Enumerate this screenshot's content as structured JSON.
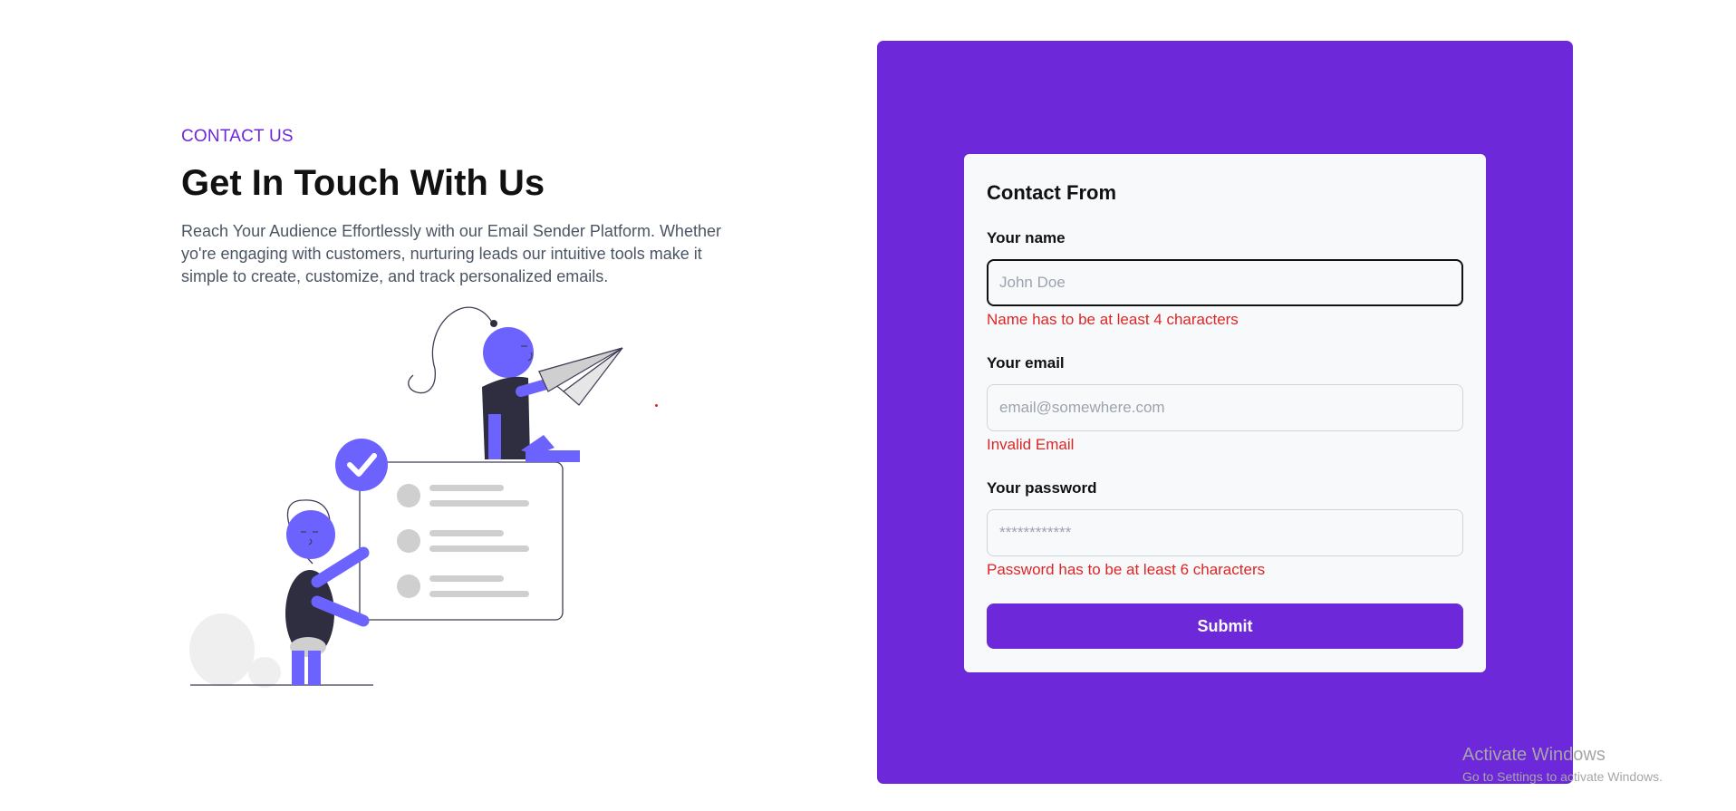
{
  "hero": {
    "eyebrow": "CONTACT US",
    "title": "Get In Touch With Us",
    "description": "Reach Your Audience Effortlessly with our Email Sender Platform. Whether yo're engaging with customers, nurturing leads our intuitive tools make it simple to create, customize, and track personalized emails."
  },
  "form": {
    "title": "Contact From",
    "name": {
      "label": "Your name",
      "value": "",
      "placeholder": "John Doe",
      "error": "Name has to be at least 4 characters",
      "focused": true
    },
    "email": {
      "label": "Your email",
      "value": "",
      "placeholder": "email@somewhere.com",
      "error": "Invalid Email"
    },
    "password": {
      "label": "Your password",
      "value": "",
      "placeholder": "************",
      "error": "Password has to be at least 6 characters"
    },
    "submit_label": "Submit"
  },
  "watermark": {
    "line1": "Activate Windows",
    "line2": "Go to Settings to activate Windows."
  },
  "colors": {
    "accent": "#6d28d9",
    "error": "#dc2626",
    "illustration": "#6c63ff"
  }
}
